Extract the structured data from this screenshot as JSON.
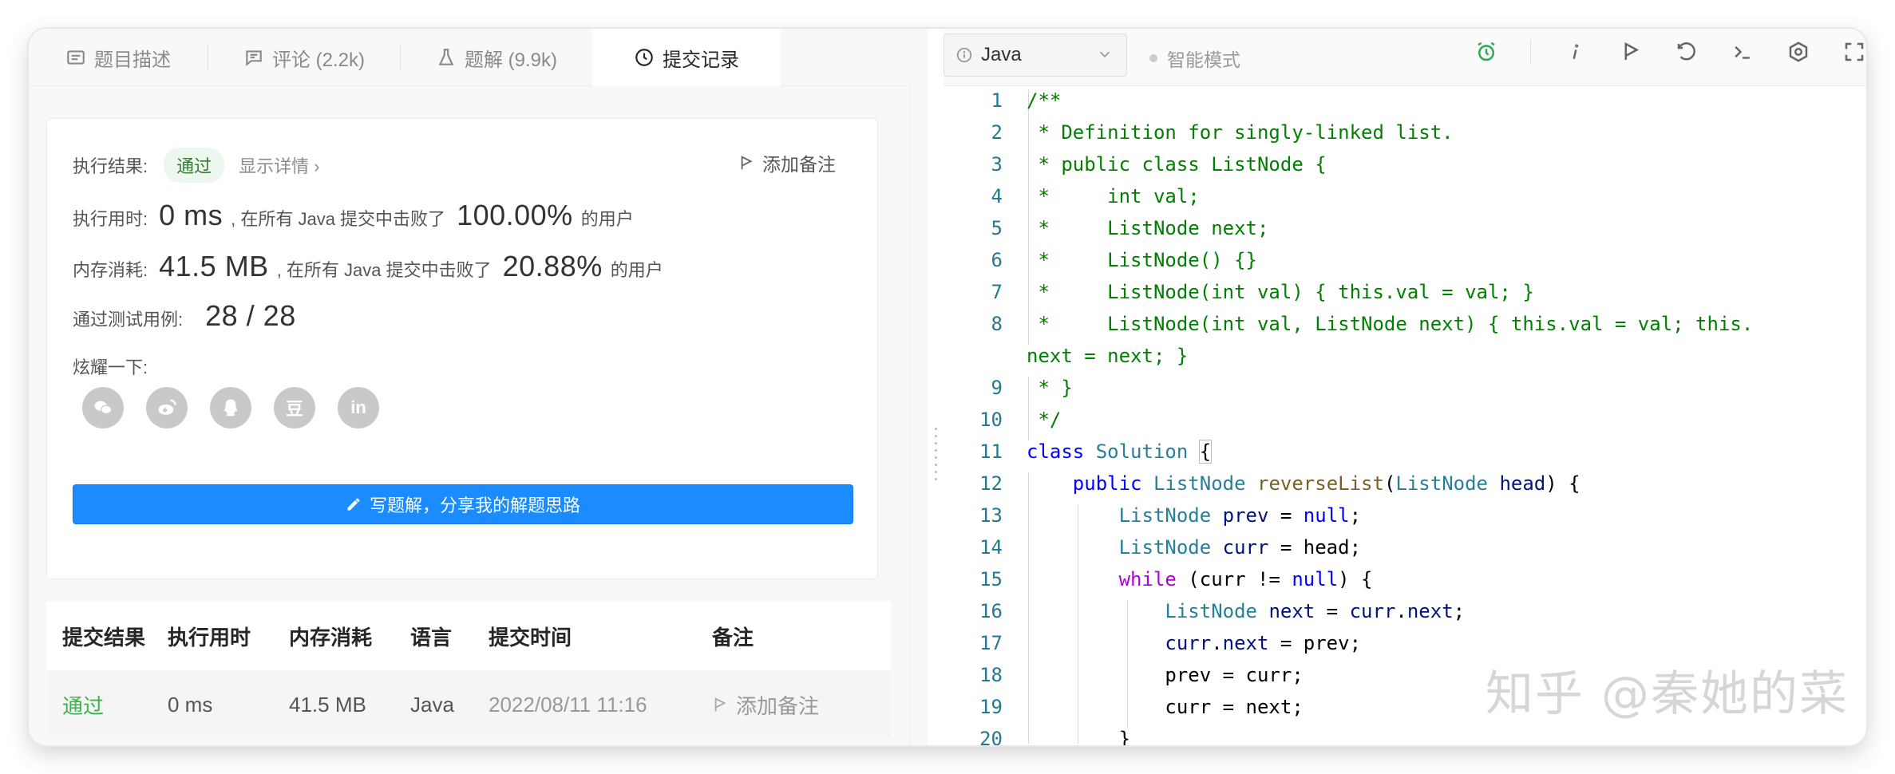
{
  "tabs": [
    {
      "label": "题目描述",
      "icon": "description-icon"
    },
    {
      "label": "评论 (2.2k)",
      "icon": "comment-icon"
    },
    {
      "label": "题解 (9.9k)",
      "icon": "flask-icon"
    },
    {
      "label": "提交记录",
      "icon": "clock-icon"
    }
  ],
  "result": {
    "result_label": "执行结果:",
    "status": "通过",
    "detail_link": "显示详情 ›",
    "add_note": "添加备注",
    "time_label": "执行用时:",
    "time_value": "0 ms",
    "time_mid": ", 在所有 Java 提交中击败了",
    "time_pct": "100.00%",
    "time_suffix": "的用户",
    "mem_label": "内存消耗:",
    "mem_value": "41.5 MB",
    "mem_mid": ", 在所有 Java 提交中击败了",
    "mem_pct": "20.88%",
    "mem_suffix": "的用户",
    "tests_label": "通过测试用例:",
    "tests_value": "28 / 28",
    "share_label": "炫耀一下:",
    "socials": [
      "wechat-icon",
      "weibo-icon",
      "qq-icon",
      "douban-icon",
      "linkedin-icon"
    ],
    "douban_glyph": "豆",
    "linkedin_glyph": "in",
    "write_button": "写题解，分享我的解题思路"
  },
  "table": {
    "headers": [
      "提交结果",
      "执行用时",
      "内存消耗",
      "语言",
      "提交时间",
      "备注"
    ],
    "rows": [
      {
        "status": "通过",
        "time": "0 ms",
        "memory": "41.5 MB",
        "lang": "Java",
        "submitted": "2022/08/11 11:16",
        "note": "添加备注"
      }
    ]
  },
  "editor": {
    "language": "Java",
    "mode": "智能模式",
    "lines": [
      "1",
      "2",
      "3",
      "4",
      "5",
      "6",
      "7",
      "8",
      "9",
      "10",
      "11",
      "12",
      "13",
      "14",
      "15",
      "16",
      "17",
      "18",
      "19",
      "20"
    ]
  },
  "watermark": "知乎 @秦她的菜",
  "colors": {
    "accent": "#1a8cff",
    "pass": "#3bb34a",
    "comment": "#008000",
    "keyword": "#0000ff"
  }
}
